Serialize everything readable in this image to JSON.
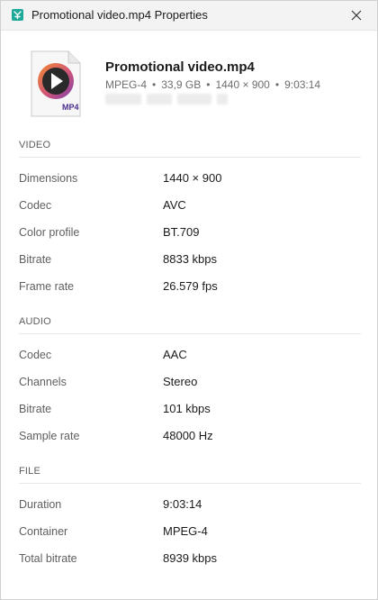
{
  "window": {
    "title": "Promotional video.mp4 Properties"
  },
  "file": {
    "name": "Promotional video.mp4",
    "format": "MPEG-4",
    "size": "33,9 GB",
    "dimensions": "1440 × 900",
    "duration": "9:03:14",
    "icon_badge": "MP4",
    "icon": "video-file-icon"
  },
  "sections": {
    "video": {
      "title": "VIDEO",
      "rows": [
        {
          "label": "Dimensions",
          "value": "1440 × 900"
        },
        {
          "label": "Codec",
          "value": "AVC"
        },
        {
          "label": "Color profile",
          "value": "BT.709"
        },
        {
          "label": "Bitrate",
          "value": "8833 kbps"
        },
        {
          "label": "Frame rate",
          "value": "26.579 fps"
        }
      ]
    },
    "audio": {
      "title": "AUDIO",
      "rows": [
        {
          "label": "Codec",
          "value": "AAC"
        },
        {
          "label": "Channels",
          "value": "Stereo"
        },
        {
          "label": "Bitrate",
          "value": "101 kbps"
        },
        {
          "label": "Sample rate",
          "value": "48000 Hz"
        }
      ]
    },
    "file": {
      "title": "FILE",
      "rows": [
        {
          "label": "Duration",
          "value": "9:03:14"
        },
        {
          "label": "Container",
          "value": "MPEG-4"
        },
        {
          "label": "Total bitrate",
          "value": "8939 kbps"
        }
      ]
    }
  },
  "colors": {
    "accent_teal": "#1ea89a",
    "play_ring_orange": "#f08a2a",
    "play_ring_purple": "#7b3fa8",
    "badge_text": "#4a2e8c"
  }
}
